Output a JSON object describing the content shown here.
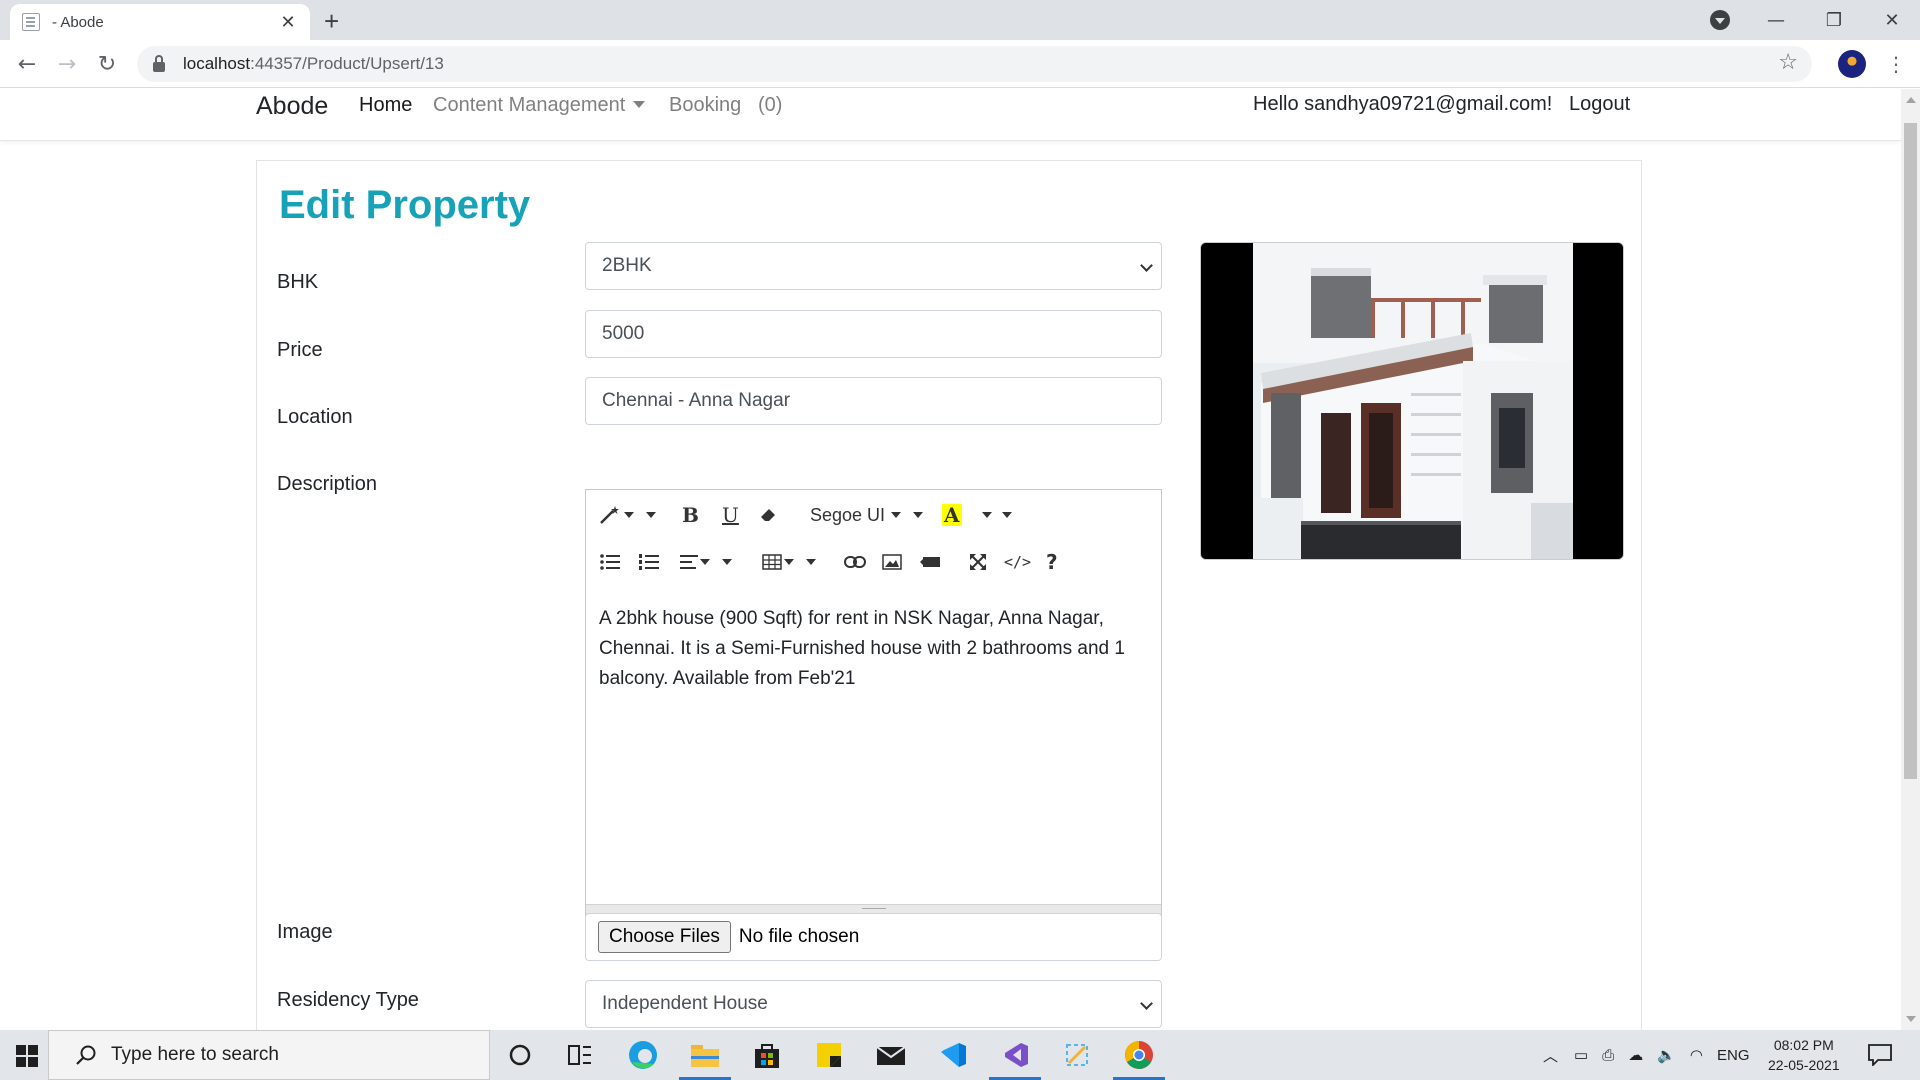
{
  "browser": {
    "tab_title": "- Abode",
    "url_host": "localhost",
    "url_rest": ":44357/Product/Upsert/13"
  },
  "navbar": {
    "brand": "Abode",
    "links": {
      "home": "Home",
      "content_management": "Content Management",
      "booking": "Booking",
      "booking_count": "(0)"
    },
    "greeting": "Hello sandhya09721@gmail.com!",
    "logout": "Logout"
  },
  "form": {
    "title": "Edit Property",
    "bhk": {
      "label": "BHK",
      "value": "2BHK"
    },
    "price": {
      "label": "Price",
      "value": "5000"
    },
    "location": {
      "label": "Location",
      "value": "Chennai - Anna Nagar"
    },
    "description": {
      "label": "Description",
      "font_name": "Segoe UI",
      "text": "A 2bhk house (900 Sqft) for rent in NSK Nagar, Anna Nagar, Chennai. It is a Semi-Furnished house with 2 bathrooms and 1 balcony. Available from Feb'21"
    },
    "image": {
      "label": "Image",
      "button": "Choose Files",
      "status": "No file chosen"
    },
    "residency_type": {
      "label": "Residency Type",
      "value": "Independent House"
    }
  },
  "taskbar": {
    "search_placeholder": "Type here to search",
    "language": "ENG",
    "time": "08:02 PM",
    "date": "22-05-2021"
  },
  "colors": {
    "title_accent": "#17a2b8",
    "taskbar_active": "#2b73c7"
  }
}
